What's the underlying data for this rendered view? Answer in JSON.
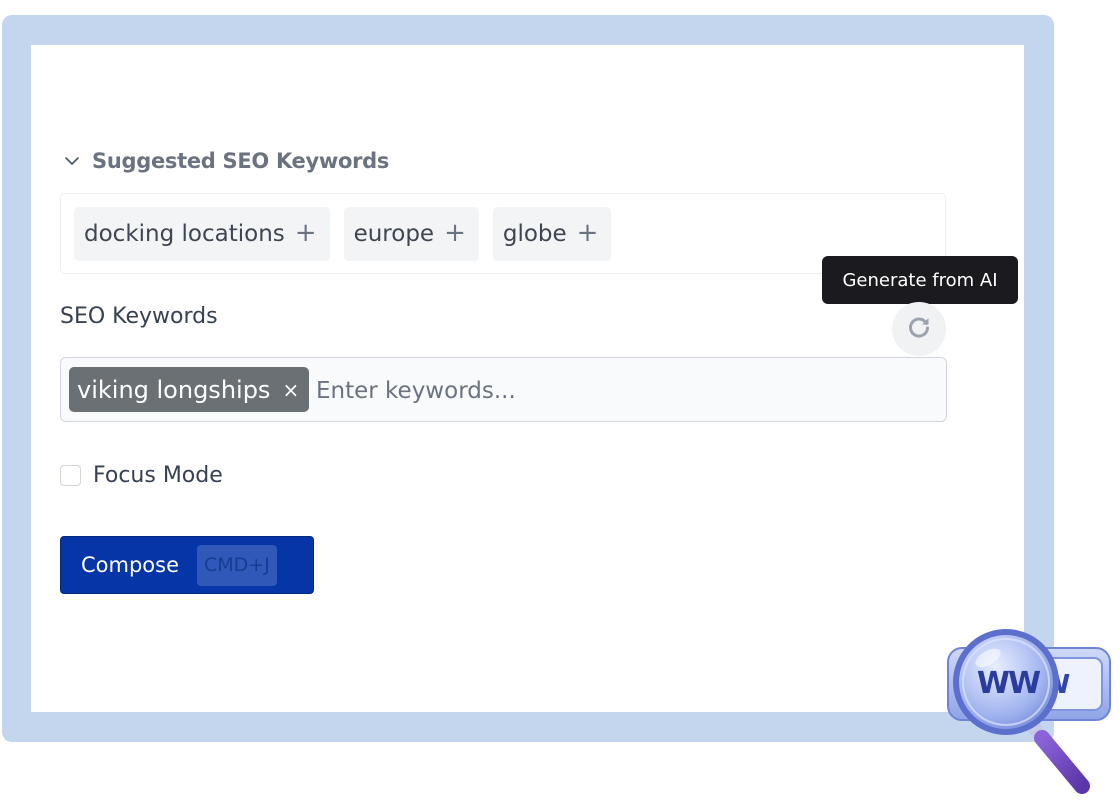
{
  "suggested": {
    "title": "Suggested SEO Keywords",
    "keywords": [
      "docking locations",
      "europe",
      "globe"
    ],
    "add_glyph": "+"
  },
  "seo": {
    "label": "SEO Keywords",
    "tooltip": "Generate from AI",
    "tags": [
      "viking longships"
    ],
    "remove_glyph": "×",
    "placeholder": "Enter keywords..."
  },
  "focus_mode": {
    "label": "Focus Mode",
    "checked": false
  },
  "compose": {
    "label": "Compose",
    "shortcut": "CMD+J"
  },
  "decor": {
    "badge_text": "WWW"
  },
  "colors": {
    "frame": "#c3d6ee",
    "primary": "#0535a6",
    "tag": "#6b7075",
    "tooltip": "#1b1b1f"
  }
}
